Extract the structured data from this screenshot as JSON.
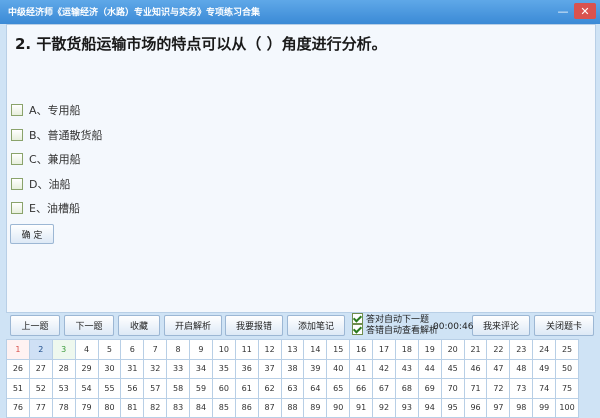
{
  "window": {
    "title": "中级经济师《运输经济（水路）专业知识与实务》专项练习合集",
    "minimize_glyph": "—",
    "close_glyph": "✕"
  },
  "question": {
    "text": "2. 干散货船运输市场的特点可以从（        ）角度进行分析。"
  },
  "options": [
    {
      "label": "A、专用船"
    },
    {
      "label": "B、普通散货船"
    },
    {
      "label": "C、兼用船"
    },
    {
      "label": "D、油船"
    },
    {
      "label": "E、油槽船"
    }
  ],
  "confirm_label": "确 定",
  "toolbar": {
    "prev": "上一题",
    "next": "下一题",
    "favorite": "收藏",
    "analysis": "开启解析",
    "report": "我要报错",
    "note": "添加笔记",
    "auto_next_label": "答对自动下一题",
    "auto_analysis_label": "答错自动查看解析",
    "timer": "00:00:46",
    "comment": "我来评论",
    "close_card": "关闭题卡"
  },
  "answer_card": [
    "1",
    "2",
    "3",
    "4",
    "5",
    "6",
    "7",
    "8",
    "9",
    "10",
    "11",
    "12",
    "13",
    "14",
    "15",
    "16",
    "17",
    "18",
    "19",
    "20",
    "21",
    "22",
    "23",
    "24",
    "25",
    "26",
    "27",
    "28",
    "29",
    "30",
    "31",
    "32",
    "33",
    "34",
    "35",
    "36",
    "37",
    "38",
    "39",
    "40",
    "41",
    "42",
    "43",
    "44",
    "45",
    "46",
    "47",
    "48",
    "49",
    "50",
    "51",
    "52",
    "53",
    "54",
    "55",
    "56",
    "57",
    "58",
    "59",
    "60",
    "61",
    "62",
    "63",
    "64",
    "65",
    "66",
    "67",
    "68",
    "69",
    "70",
    "71",
    "72",
    "73",
    "74",
    "75",
    "76",
    "77",
    "78",
    "79",
    "80",
    "81",
    "82",
    "83",
    "84",
    "85",
    "86",
    "87",
    "88",
    "89",
    "90",
    "91",
    "92",
    "93",
    "94",
    "95",
    "96",
    "97",
    "98",
    "99",
    "100"
  ]
}
